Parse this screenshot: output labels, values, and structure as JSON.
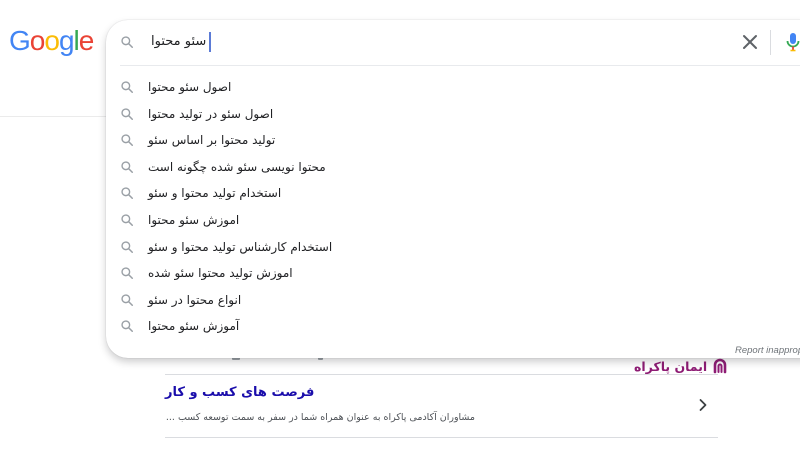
{
  "logo": {
    "letters": [
      "G",
      "o",
      "o",
      "g",
      "l",
      "e"
    ],
    "colors": [
      "#4285f4",
      "#ea4335",
      "#fbbc05",
      "#4285f4",
      "#34a853",
      "#ea4335"
    ]
  },
  "search": {
    "query": "سئو محتوا",
    "icon": "search-icon",
    "clear_icon": "close-icon",
    "mic_icon": "microphone-icon"
  },
  "suggestions": [
    "اصول سئو محتوا",
    "اصول سئو در تولید محتوا",
    "تولید محتوا بر اساس سئو",
    "محتوا نویسی سئو شده چگونه است",
    "استخدام تولید محتوا و سئو",
    "اموزش سئو محتوا",
    "استخدام کارشناس تولید محتوا و سئو",
    "اموزش تولید محتوا سئو شده",
    "انواع محتوا در سئو",
    "آموزش سئو محتوا"
  ],
  "report_label": "Report inappropriate predictions",
  "result": {
    "brand_name": "ایمان پاکراه",
    "brand_icon": "brand-mark-icon",
    "title": "فرصت های کسب و کار",
    "snippet": "مشاوران آکادمی پاکراه به عنوان همراه شما در سفر به سمت توسعه کسب ...",
    "chevron_icon": "chevron-right-icon"
  },
  "colors": {
    "link_blue": "#1a0dab",
    "brand_purple": "#8e1c74",
    "text": "#202124",
    "muted": "#70757a"
  }
}
